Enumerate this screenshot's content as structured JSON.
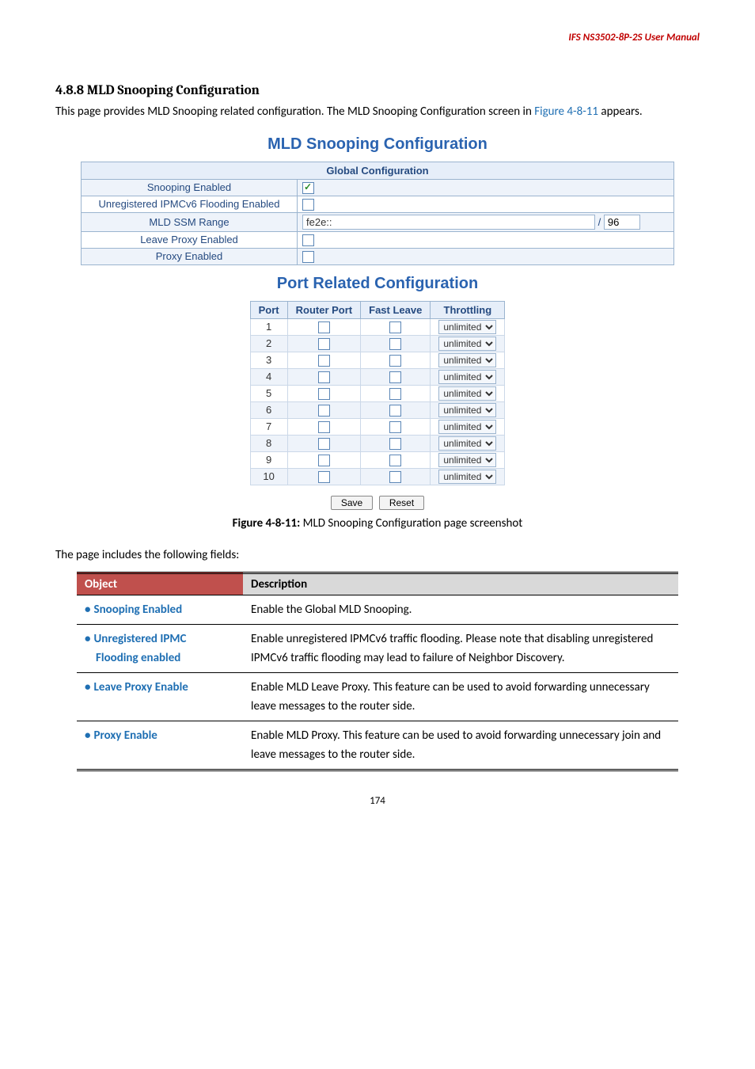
{
  "header": {
    "title": "IFS  NS3502-8P-2S  User  Manual"
  },
  "section": {
    "heading": "4.8.8 MLD Snooping Configuration",
    "intro_prefix": "This page provides MLD Snooping related configuration. The MLD Snooping Configuration screen in ",
    "intro_figref": "Figure 4-8-11",
    "intro_suffix": " appears."
  },
  "mld_panel": {
    "title": "MLD Snooping Configuration",
    "global_header": "Global Configuration",
    "rows": {
      "snooping_label": "Snooping Enabled",
      "unreg_label": "Unregistered IPMCv6 Flooding Enabled",
      "ssm_label": "MLD SSM Range",
      "ssm_value": "fe2e::",
      "ssm_slash": " / ",
      "ssm_prefix": "96",
      "leave_label": "Leave Proxy Enabled",
      "proxy_label": "Proxy Enabled"
    }
  },
  "port_panel": {
    "title": "Port Related Configuration",
    "headers": {
      "port": "Port",
      "router": "Router Port",
      "fast": "Fast Leave",
      "throttle": "Throttling"
    },
    "throttle_option": "unlimited",
    "ports": [
      "1",
      "2",
      "3",
      "4",
      "5",
      "6",
      "7",
      "8",
      "9",
      "10"
    ],
    "buttons": {
      "save": "Save",
      "reset": "Reset"
    }
  },
  "figure_caption": {
    "strong": "Figure 4-8-11:",
    "rest": " MLD Snooping Configuration page screenshot"
  },
  "fields_intro": "The page includes the following fields:",
  "desc_table": {
    "headers": {
      "object": "Object",
      "description": "Description"
    },
    "rows": [
      {
        "object": "Snooping Enabled",
        "desc": "Enable the Global MLD Snooping."
      },
      {
        "object_line1": "Unregistered IPMC",
        "object_line2": "Flooding enabled",
        "desc": "Enable unregistered IPMCv6 traffic flooding. Please note that disabling unregistered IPMCv6 traffic flooding may lead to failure of Neighbor Discovery."
      },
      {
        "object": "Leave Proxy Enable",
        "desc": "Enable MLD Leave Proxy. This feature can be used to avoid forwarding unnecessary leave messages to the router side."
      },
      {
        "object": "Proxy Enable",
        "desc": "Enable MLD Proxy. This feature can be used to avoid forwarding unnecessary join and leave messages to the router side."
      }
    ]
  },
  "page_number": "174"
}
